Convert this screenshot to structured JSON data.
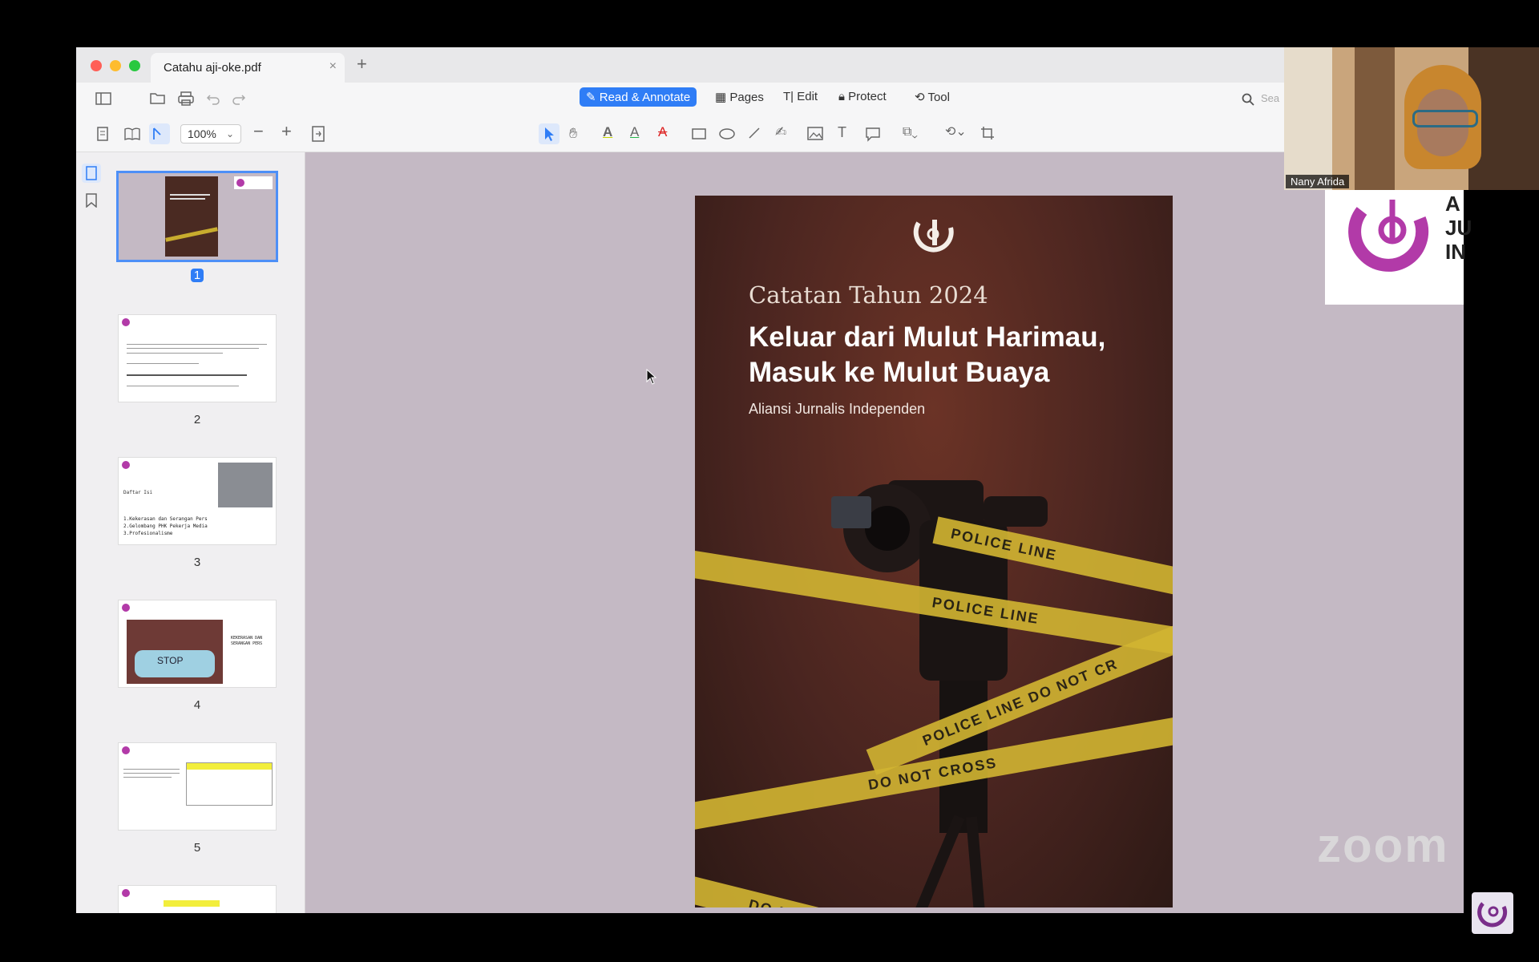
{
  "tab": {
    "title": "Catahu aji-oke.pdf",
    "close": "×",
    "new": "+"
  },
  "modes": [
    {
      "label": "Read & Annotate",
      "active": true
    },
    {
      "label": "Pages"
    },
    {
      "label": "Edit"
    },
    {
      "label": "Protect"
    },
    {
      "label": "Tool"
    }
  ],
  "zoom": {
    "value": "100%"
  },
  "search": {
    "placeholder": "Sea"
  },
  "thumbnails": [
    {
      "page": "1",
      "selected": true
    },
    {
      "page": "2"
    },
    {
      "page": "3"
    },
    {
      "page": "4"
    },
    {
      "page": "5"
    }
  ],
  "thumb_text": {
    "p3_title": "Daftar Isi",
    "p3_items": [
      "1.Kekerasan dan Serangan Pers",
      "2.Gelombang PHK Pekerja Media",
      "3.Profesionalisme"
    ],
    "p4_mask": "STOP",
    "p4_heading": "KEKERASAN DAN SERANGAN PERS"
  },
  "cover": {
    "kicker": "Catatan Tahun 2024",
    "title_line1": "Keluar dari Mulut Harimau,",
    "title_line2": "Masuk ke Mulut Buaya",
    "org": "Aliansi Jurnalis Independen",
    "tape1": "POLICE LINE",
    "tape2": "POLICE LINE DO NOT CR",
    "tape3": "DO NOT CROSS",
    "tape4": "DO NOT CROSS",
    "tape5": "POLICE LINE",
    "colors": {
      "tape": "#d2b532",
      "cover_bg": "#4a2520"
    }
  },
  "video": {
    "participant_name": "Nany Afrida"
  },
  "logo_card": {
    "text_fragments": [
      "A",
      "JU",
      "IN"
    ]
  },
  "watermark": {
    "text": "zoom"
  }
}
